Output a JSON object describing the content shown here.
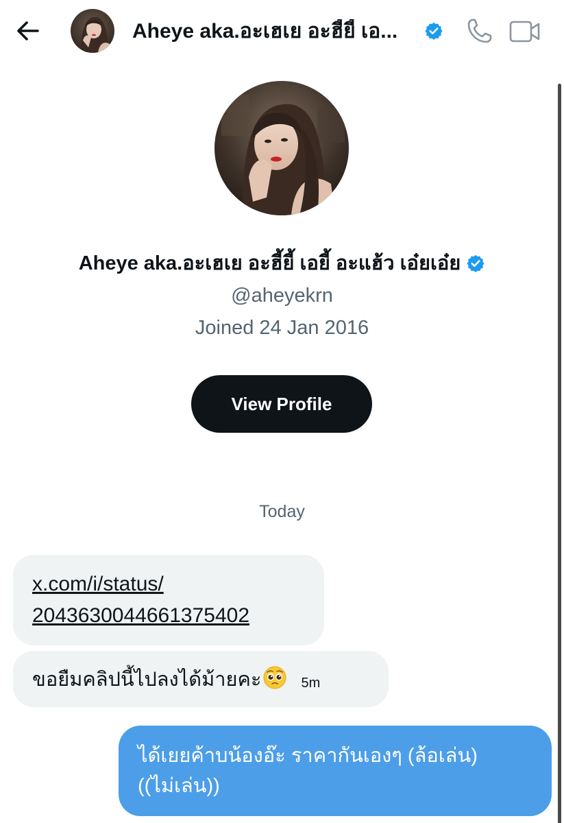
{
  "header": {
    "back_icon": "arrow-left-icon",
    "title": "Aheye aka.อะเฮเย อะฮี้ยี้ เอ...",
    "verified_icon": "verified-badge-icon",
    "call_icon": "phone-icon",
    "video_icon": "video-camera-icon"
  },
  "profile": {
    "name": "Aheye aka.อะเฮเย อะฮี้ยี้ เอยี้ อะแฮ้ว เอ๋ยเอ๋ย",
    "handle": "@aheyekrn",
    "joined": "Joined 24 Jan 2016",
    "view_profile_label": "View Profile"
  },
  "conversation": {
    "day_label": "Today",
    "messages": [
      {
        "direction": "incoming",
        "type": "link",
        "lines": [
          "x.com/i/status/",
          "2043630044661375402"
        ]
      },
      {
        "direction": "incoming",
        "type": "text",
        "text": "ขอยืมคลิปนี้ไปลงได้ม้ายคะ",
        "emoji": "pleading-face-icon",
        "time": "5m"
      },
      {
        "direction": "outgoing",
        "type": "text",
        "lines": [
          "ได้เยยค้าบน้องอ๊ะ ราคากันเองๆ (ล้อเล่น)",
          "((ไม่เล่น))"
        ]
      }
    ]
  },
  "colors": {
    "accent_blue": "#1d9bf0",
    "outgoing_bubble": "#4c9ee8",
    "incoming_bubble": "#eff3f4",
    "primary_text": "#0f1419",
    "secondary_text": "#536471",
    "button_dark": "#0f1419"
  }
}
